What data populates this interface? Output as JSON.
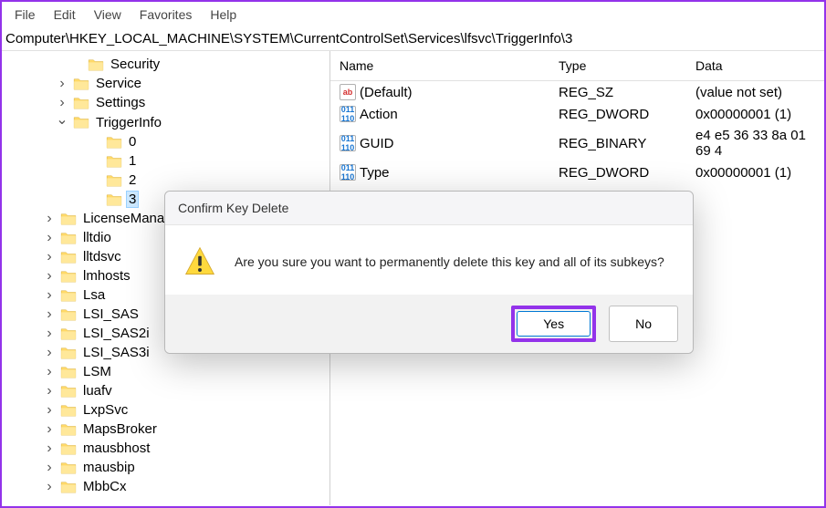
{
  "menu": {
    "file": "File",
    "edit": "Edit",
    "view": "View",
    "favorites": "Favorites",
    "help": "Help"
  },
  "address": "Computer\\HKEY_LOCAL_MACHINE\\SYSTEM\\CurrentControlSet\\Services\\lfsvc\\TriggerInfo\\3",
  "columns": {
    "name": "Name",
    "type": "Type",
    "data": "Data"
  },
  "values": [
    {
      "icon": "ab",
      "name": "(Default)",
      "type": "REG_SZ",
      "data": "(value not set)"
    },
    {
      "icon": "bin",
      "name": "Action",
      "type": "REG_DWORD",
      "data": "0x00000001 (1)"
    },
    {
      "icon": "bin",
      "name": "GUID",
      "type": "REG_BINARY",
      "data": "e4 e5 36 33 8a 01 69 4"
    },
    {
      "icon": "bin",
      "name": "Type",
      "type": "REG_DWORD",
      "data": "0x00000001 (1)"
    }
  ],
  "tree": {
    "security": "Security",
    "service": "Service",
    "settings": "Settings",
    "triggerinfo": "TriggerInfo",
    "t0": "0",
    "t1": "1",
    "t2": "2",
    "t3": "3",
    "licensemanager": "LicenseManag",
    "lltdio": "lltdio",
    "lltdsvc": "lltdsvc",
    "lmhosts": "lmhosts",
    "lsa": "Lsa",
    "lsi_sas": "LSI_SAS",
    "lsi_sas2i": "LSI_SAS2i",
    "lsi_sas3i": "LSI_SAS3i",
    "lsm": "LSM",
    "luafv": "luafv",
    "lxpsvc": "LxpSvc",
    "mapsbroker": "MapsBroker",
    "mausbhost": "mausbhost",
    "mausbip": "mausbip",
    "mbbcx": "MbbCx"
  },
  "dialog": {
    "title": "Confirm Key Delete",
    "message": "Are you sure you want to permanently delete this key and all of its subkeys?",
    "yes": "Yes",
    "no": "No"
  }
}
